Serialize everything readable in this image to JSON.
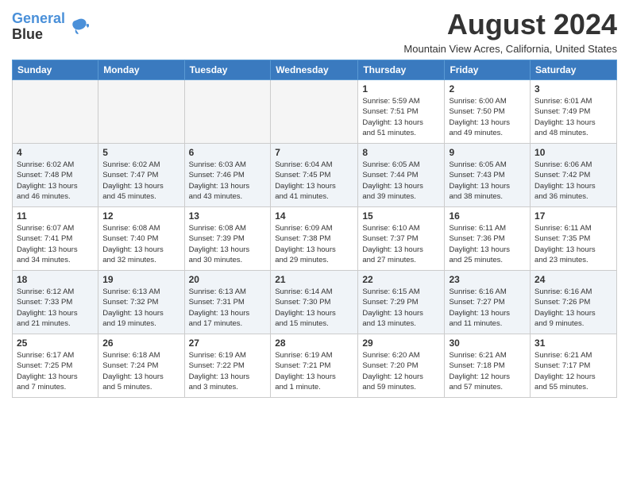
{
  "logo": {
    "line1": "General",
    "line2": "Blue"
  },
  "title": "August 2024",
  "subtitle": "Mountain View Acres, California, United States",
  "weekdays": [
    "Sunday",
    "Monday",
    "Tuesday",
    "Wednesday",
    "Thursday",
    "Friday",
    "Saturday"
  ],
  "weeks": [
    [
      {
        "day": "",
        "info": ""
      },
      {
        "day": "",
        "info": ""
      },
      {
        "day": "",
        "info": ""
      },
      {
        "day": "",
        "info": ""
      },
      {
        "day": "1",
        "info": "Sunrise: 5:59 AM\nSunset: 7:51 PM\nDaylight: 13 hours\nand 51 minutes."
      },
      {
        "day": "2",
        "info": "Sunrise: 6:00 AM\nSunset: 7:50 PM\nDaylight: 13 hours\nand 49 minutes."
      },
      {
        "day": "3",
        "info": "Sunrise: 6:01 AM\nSunset: 7:49 PM\nDaylight: 13 hours\nand 48 minutes."
      }
    ],
    [
      {
        "day": "4",
        "info": "Sunrise: 6:02 AM\nSunset: 7:48 PM\nDaylight: 13 hours\nand 46 minutes."
      },
      {
        "day": "5",
        "info": "Sunrise: 6:02 AM\nSunset: 7:47 PM\nDaylight: 13 hours\nand 45 minutes."
      },
      {
        "day": "6",
        "info": "Sunrise: 6:03 AM\nSunset: 7:46 PM\nDaylight: 13 hours\nand 43 minutes."
      },
      {
        "day": "7",
        "info": "Sunrise: 6:04 AM\nSunset: 7:45 PM\nDaylight: 13 hours\nand 41 minutes."
      },
      {
        "day": "8",
        "info": "Sunrise: 6:05 AM\nSunset: 7:44 PM\nDaylight: 13 hours\nand 39 minutes."
      },
      {
        "day": "9",
        "info": "Sunrise: 6:05 AM\nSunset: 7:43 PM\nDaylight: 13 hours\nand 38 minutes."
      },
      {
        "day": "10",
        "info": "Sunrise: 6:06 AM\nSunset: 7:42 PM\nDaylight: 13 hours\nand 36 minutes."
      }
    ],
    [
      {
        "day": "11",
        "info": "Sunrise: 6:07 AM\nSunset: 7:41 PM\nDaylight: 13 hours\nand 34 minutes."
      },
      {
        "day": "12",
        "info": "Sunrise: 6:08 AM\nSunset: 7:40 PM\nDaylight: 13 hours\nand 32 minutes."
      },
      {
        "day": "13",
        "info": "Sunrise: 6:08 AM\nSunset: 7:39 PM\nDaylight: 13 hours\nand 30 minutes."
      },
      {
        "day": "14",
        "info": "Sunrise: 6:09 AM\nSunset: 7:38 PM\nDaylight: 13 hours\nand 29 minutes."
      },
      {
        "day": "15",
        "info": "Sunrise: 6:10 AM\nSunset: 7:37 PM\nDaylight: 13 hours\nand 27 minutes."
      },
      {
        "day": "16",
        "info": "Sunrise: 6:11 AM\nSunset: 7:36 PM\nDaylight: 13 hours\nand 25 minutes."
      },
      {
        "day": "17",
        "info": "Sunrise: 6:11 AM\nSunset: 7:35 PM\nDaylight: 13 hours\nand 23 minutes."
      }
    ],
    [
      {
        "day": "18",
        "info": "Sunrise: 6:12 AM\nSunset: 7:33 PM\nDaylight: 13 hours\nand 21 minutes."
      },
      {
        "day": "19",
        "info": "Sunrise: 6:13 AM\nSunset: 7:32 PM\nDaylight: 13 hours\nand 19 minutes."
      },
      {
        "day": "20",
        "info": "Sunrise: 6:13 AM\nSunset: 7:31 PM\nDaylight: 13 hours\nand 17 minutes."
      },
      {
        "day": "21",
        "info": "Sunrise: 6:14 AM\nSunset: 7:30 PM\nDaylight: 13 hours\nand 15 minutes."
      },
      {
        "day": "22",
        "info": "Sunrise: 6:15 AM\nSunset: 7:29 PM\nDaylight: 13 hours\nand 13 minutes."
      },
      {
        "day": "23",
        "info": "Sunrise: 6:16 AM\nSunset: 7:27 PM\nDaylight: 13 hours\nand 11 minutes."
      },
      {
        "day": "24",
        "info": "Sunrise: 6:16 AM\nSunset: 7:26 PM\nDaylight: 13 hours\nand 9 minutes."
      }
    ],
    [
      {
        "day": "25",
        "info": "Sunrise: 6:17 AM\nSunset: 7:25 PM\nDaylight: 13 hours\nand 7 minutes."
      },
      {
        "day": "26",
        "info": "Sunrise: 6:18 AM\nSunset: 7:24 PM\nDaylight: 13 hours\nand 5 minutes."
      },
      {
        "day": "27",
        "info": "Sunrise: 6:19 AM\nSunset: 7:22 PM\nDaylight: 13 hours\nand 3 minutes."
      },
      {
        "day": "28",
        "info": "Sunrise: 6:19 AM\nSunset: 7:21 PM\nDaylight: 13 hours\nand 1 minute."
      },
      {
        "day": "29",
        "info": "Sunrise: 6:20 AM\nSunset: 7:20 PM\nDaylight: 12 hours\nand 59 minutes."
      },
      {
        "day": "30",
        "info": "Sunrise: 6:21 AM\nSunset: 7:18 PM\nDaylight: 12 hours\nand 57 minutes."
      },
      {
        "day": "31",
        "info": "Sunrise: 6:21 AM\nSunset: 7:17 PM\nDaylight: 12 hours\nand 55 minutes."
      }
    ]
  ]
}
